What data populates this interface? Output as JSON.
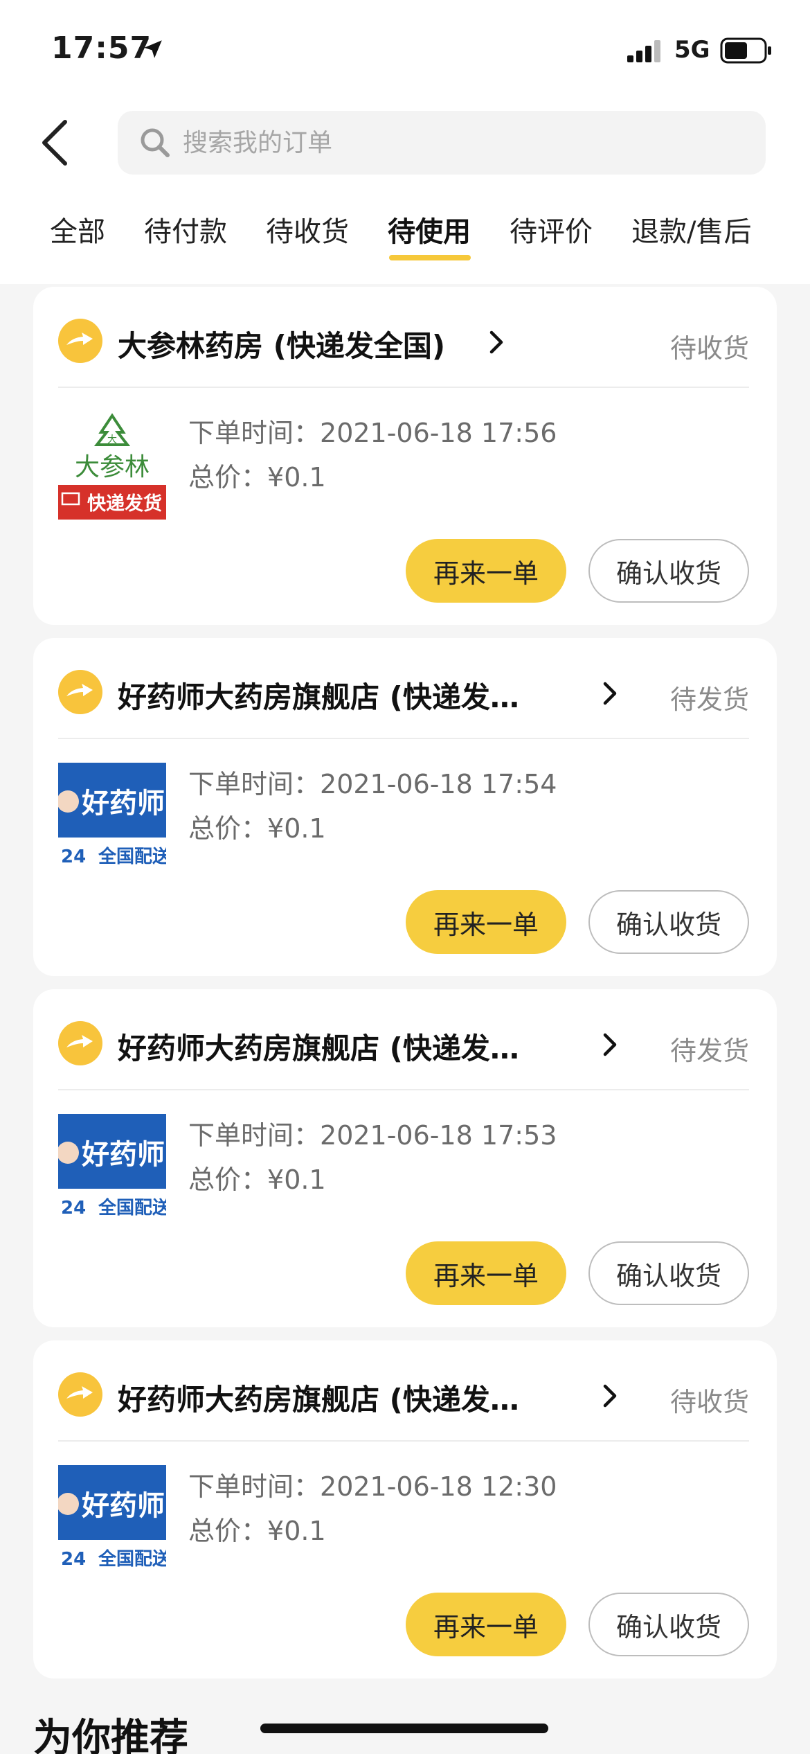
{
  "status_bar": {
    "time": "17:57",
    "network": "5G"
  },
  "search": {
    "placeholder": "搜索我的订单"
  },
  "tabs": [
    {
      "label": "全部"
    },
    {
      "label": "待付款"
    },
    {
      "label": "待收货"
    },
    {
      "label": "待使用",
      "active": true
    },
    {
      "label": "待评价"
    },
    {
      "label": "退款/售后"
    }
  ],
  "orders": [
    {
      "shop": "大参林药房 (快递发全国)",
      "status": "待收货",
      "thumb_text": [
        "大参林",
        "快递发货"
      ],
      "time_label": "下单时间：",
      "time": "2021-06-18 17:56",
      "price_label": "总价：",
      "price": "¥0.1",
      "reorder": "再来一单",
      "confirm": "确认收货"
    },
    {
      "shop": "好药师大药房旗舰店 (快递发…",
      "status": "待发货",
      "thumb_text": [
        "好药师",
        "24",
        "全国配送"
      ],
      "time_label": "下单时间：",
      "time": "2021-06-18 17:54",
      "price_label": "总价：",
      "price": "¥0.1",
      "reorder": "再来一单",
      "confirm": "确认收货"
    },
    {
      "shop": "好药师大药房旗舰店 (快递发…",
      "status": "待发货",
      "thumb_text": [
        "好药师",
        "24",
        "全国配送"
      ],
      "time_label": "下单时间：",
      "time": "2021-06-18 17:53",
      "price_label": "总价：",
      "price": "¥0.1",
      "reorder": "再来一单",
      "confirm": "确认收货"
    },
    {
      "shop": "好药师大药房旗舰店 (快递发…",
      "status": "待收货",
      "thumb_text": [
        "好药师",
        "24",
        "全国配送"
      ],
      "time_label": "下单时间：",
      "time": "2021-06-18 12:30",
      "price_label": "总价：",
      "price": "¥0.1",
      "reorder": "再来一单",
      "confirm": "确认收货"
    }
  ],
  "recommend_title": "为你推荐",
  "colors": {
    "accent": "#f6cd3f",
    "shop_icon": "#f8c43c",
    "status_text": "#8a8a8a",
    "dsl_green": "#3c8c3a",
    "dsl_red": "#d6312a",
    "hys_blue": "#1f5fb8"
  }
}
